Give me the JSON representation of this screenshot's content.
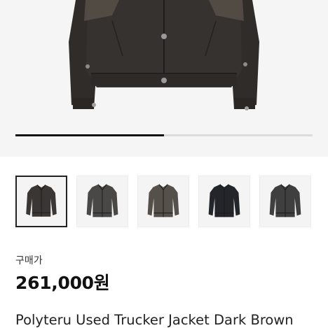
{
  "product": {
    "gallery": {
      "progress": 0.5,
      "thumbnails": [
        {
          "alt": "jacket-front-dark-brown",
          "color": "#3a3634",
          "selected": true
        },
        {
          "alt": "jacket-front-grey",
          "color": "#4a4846",
          "selected": false
        },
        {
          "alt": "jacket-front-washed",
          "color": "#55504a",
          "selected": false
        },
        {
          "alt": "jacket-front-black",
          "color": "#23252b",
          "selected": false
        },
        {
          "alt": "jacket-front-charcoal",
          "color": "#3f3f3f",
          "selected": false
        }
      ]
    },
    "price_label": "구매가",
    "price": "261,000원",
    "title": "Polyteru Used Trucker Jacket Dark Brown"
  }
}
